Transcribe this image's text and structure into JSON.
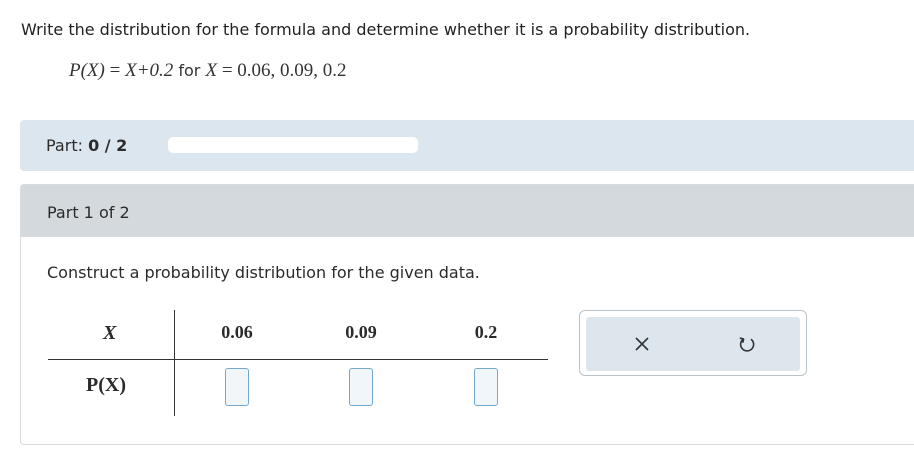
{
  "question": {
    "intro": "Write the distribution for the formula and determine whether it is a probability distribution.",
    "formula_lhs": "P(X)",
    "formula_eq": " = ",
    "formula_rhs": "X+0.2",
    "formula_for": " for ",
    "formula_var": "X",
    "formula_values": " = 0.06, 0.09, 0.2"
  },
  "progress": {
    "label": "Part: ",
    "score": "0 / 2",
    "fraction": 0
  },
  "part": {
    "header": "Part 1 of 2",
    "instruction": "Construct a probability distribution for the given data."
  },
  "table": {
    "x_label": "X",
    "p_label": "P(X)",
    "x_values": [
      "0.06",
      "0.09",
      "0.2"
    ]
  },
  "tools": {
    "clear_icon": "close-icon",
    "reset_icon": "undo-icon"
  },
  "colors": {
    "progress_bar_bg": "#dbe6ef",
    "part_header_bg": "#d3d9dc",
    "input_border": "#74a8cc"
  }
}
